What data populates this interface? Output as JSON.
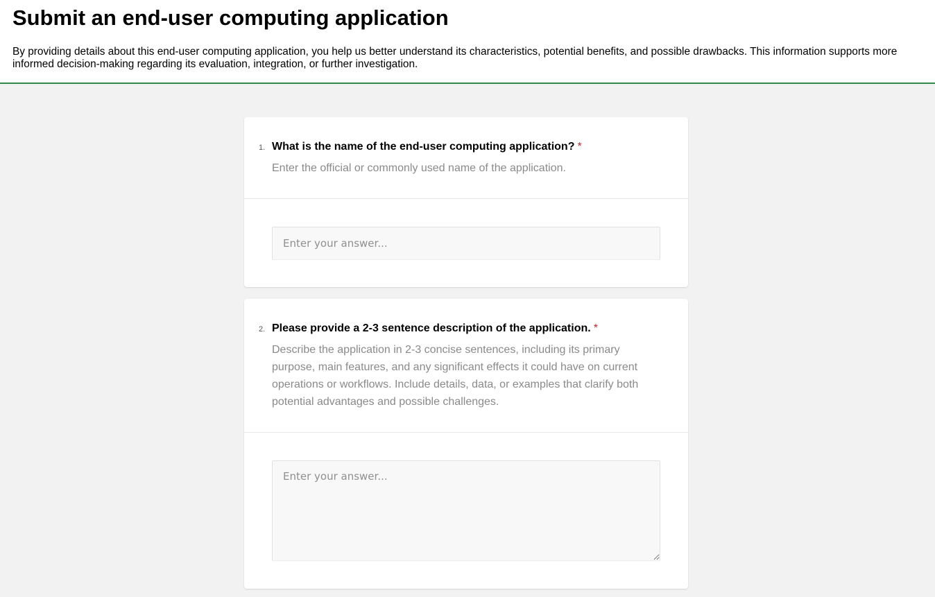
{
  "header": {
    "title": "Submit an end-user computing application",
    "description": "By providing details about this end-user computing application, you help us better understand its characteristics, potential benefits, and possible drawbacks. This information supports more informed decision-making regarding its evaluation, integration, or further investigation."
  },
  "questions": [
    {
      "number": "1.",
      "title": "What is the name of the end-user computing application?",
      "required_mark": "*",
      "help": "Enter the official or commonly used name of the application.",
      "placeholder": "Enter your answer...",
      "value": ""
    },
    {
      "number": "2.",
      "title": "Please provide a 2-3 sentence description of the application.",
      "required_mark": "*",
      "help": "Describe the application in 2-3 concise sentences, including its primary purpose, main features, and any significant effects it could have on current operations or workflows. Include details, data, or examples that clarify both potential advantages and possible challenges.",
      "placeholder": "Enter your answer...",
      "value": ""
    }
  ],
  "colors": {
    "accent_border": "#2e8b47",
    "required": "#c4262e",
    "background": "#f2f2f2"
  }
}
